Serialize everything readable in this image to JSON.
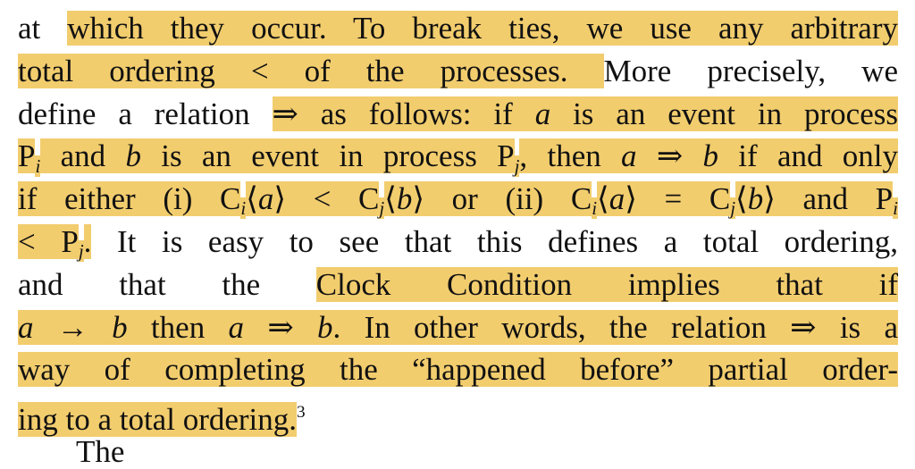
{
  "highlight_color": "#f2cd6e",
  "lines": [
    [
      [
        "at ",
        ""
      ],
      [
        "which they occur. To break ties, we use any arbitrary",
        "h"
      ]
    ],
    [
      [
        "total ordering < of the processes. ",
        "h"
      ],
      [
        "More precisely, we",
        ""
      ]
    ],
    [
      [
        "define a relation ",
        ""
      ],
      [
        "⇒ as follows: if ",
        "h"
      ],
      [
        "a",
        "hi"
      ],
      [
        " is an event in process",
        "h"
      ]
    ],
    [
      [
        "P",
        "h"
      ],
      [
        "i",
        "hs"
      ],
      [
        " and ",
        "h"
      ],
      [
        "b",
        "hi"
      ],
      [
        " is an event in process P",
        "h"
      ],
      [
        "j",
        "hs"
      ],
      [
        ", then ",
        "h"
      ],
      [
        "a",
        "hi"
      ],
      [
        " ⇒ ",
        "h"
      ],
      [
        "b",
        "hi"
      ],
      [
        " if and only",
        "h"
      ]
    ],
    [
      [
        "if either (i) C",
        "h"
      ],
      [
        "i",
        "hs"
      ],
      [
        "⟨",
        "h"
      ],
      [
        "a",
        "hi"
      ],
      [
        "⟩ < C",
        "h"
      ],
      [
        "j",
        "hs"
      ],
      [
        "⟨",
        "h"
      ],
      [
        "b",
        "hi"
      ],
      [
        "⟩ or (ii) C",
        "h"
      ],
      [
        "i",
        "hs"
      ],
      [
        "⟨",
        "h"
      ],
      [
        "a",
        "hi"
      ],
      [
        "⟩ = C",
        "h"
      ],
      [
        "j",
        "hs"
      ],
      [
        "⟨",
        "h"
      ],
      [
        "b",
        "hi"
      ],
      [
        "⟩ and P",
        "h"
      ],
      [
        "i",
        "hs"
      ]
    ],
    [
      [
        "< P",
        "h"
      ],
      [
        "j",
        "hs"
      ],
      [
        ".",
        "h"
      ],
      [
        " It is easy to see that this defines a total ordering,",
        ""
      ]
    ],
    [
      [
        "and that the ",
        ""
      ],
      [
        "Clock Condition implies that if",
        "h"
      ]
    ],
    [
      [
        "a",
        "hi"
      ],
      [
        " → ",
        "h"
      ],
      [
        "b",
        "hi"
      ],
      [
        " then ",
        "h"
      ],
      [
        "a",
        "hi"
      ],
      [
        " ⇒ ",
        "h"
      ],
      [
        "b",
        "hi"
      ],
      [
        ". In other words, the relation ⇒ is a",
        "h"
      ]
    ],
    [
      [
        "way of completing the “happened before” partial order-",
        "h"
      ]
    ],
    [
      [
        "ing to a total ordering.",
        "h"
      ],
      [
        "3",
        "u"
      ]
    ]
  ],
  "cut_line": "The"
}
